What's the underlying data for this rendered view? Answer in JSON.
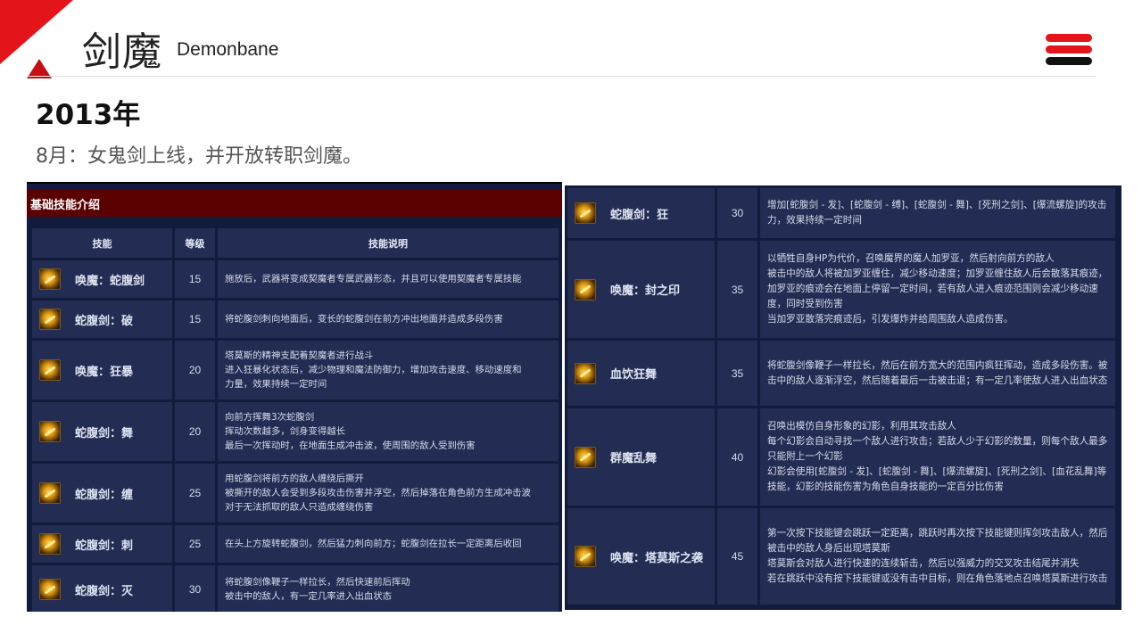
{
  "header": {
    "title": "剑魔",
    "subtitle": "Demonbane",
    "brand_red": "#e3151b"
  },
  "section": {
    "year": "2013年",
    "note": "8月：女鬼剑上线，并开放转职剑魔。"
  },
  "left_table": {
    "caption": "基础技能介绍",
    "headers": [
      "技能",
      "等级",
      "技能说明"
    ],
    "rows": [
      {
        "icon": "sword-summon-icon",
        "name": "唤魔：蛇腹剑",
        "level": "15",
        "desc": [
          "施放后，武器将变成契魔者专属武器形态，并且可以使用契魔者专属技能"
        ]
      },
      {
        "icon": "sword-break-icon",
        "name": "蛇腹剑：破",
        "level": "15",
        "desc": [
          "将蛇腹剑刺向地面后，变长的蛇腹剑在前方冲出地面并造成多段伤害"
        ]
      },
      {
        "icon": "frenzy-icon",
        "name": "唤魔：狂暴",
        "level": "20",
        "desc": [
          "塔莫斯的精神支配着契魔者进行战斗",
          "进入狂暴化状态后，减少物理和魔法防御力，增加攻击速度、移动速度和",
          "力量，效果持续一定时间"
        ]
      },
      {
        "icon": "sword-dance-icon",
        "name": "蛇腹剑：舞",
        "level": "20",
        "desc": [
          "向前方挥舞3次蛇腹剑",
          "挥动次数越多，剑身变得越长",
          "最后一次挥动时，在地面生成冲击波，使周围的敌人受到伤害"
        ]
      },
      {
        "icon": "sword-bind-icon",
        "name": "蛇腹剑：缠",
        "level": "25",
        "desc": [
          "用蛇腹剑将前方的敌人缠绕后撕开",
          "被撕开的敌人会受到多段攻击伤害并浮空，然后掉落在角色前方生成冲击波",
          "对于无法抓取的敌人只造成缠绕伤害"
        ]
      },
      {
        "icon": "sword-pierce-icon",
        "name": "蛇腹剑：刺",
        "level": "25",
        "desc": [
          "在头上方旋转蛇腹剑，然后猛力刺向前方；蛇腹剑在拉长一定距离后收回"
        ]
      },
      {
        "icon": "sword-destroy-icon",
        "name": "蛇腹剑：灭",
        "level": "30",
        "desc": [
          "将蛇腹剑像鞭子一样拉长，然后快速前后挥动",
          "被击中的敌人，有一定几率进入出血状态"
        ]
      }
    ]
  },
  "right_table": {
    "rows": [
      {
        "icon": "sword-frenzy-icon",
        "name": "蛇腹剑：狂",
        "level": "30",
        "desc": [
          "增加[蛇腹剑 - 发]、[蛇腹剑 - 缚]、[蛇腹剑 - 舞]、[死刑之剑]、[爆流螺旋]的攻击力，效果持续一定时间"
        ]
      },
      {
        "icon": "seal-icon",
        "name": "唤魔：封之印",
        "level": "35",
        "desc": [
          "以牺牲自身HP为代价，召唤魔界的魔人加罗亚，然后射向前方的敌人",
          "被击中的敌人将被加罗亚缠住，减少移动速度；加罗亚缠住敌人后会散落其痕迹，加罗亚的痕迹会在地面上停留一定时间，若有敌人进入痕迹范围则会减少移动速度，同时受到伤害",
          "当加罗亚散落完痕迹后，引发爆炸并给周围敌人造成伤害。"
        ]
      },
      {
        "icon": "blood-dance-icon",
        "name": "血饮狂舞",
        "level": "35",
        "desc": [
          "将蛇腹剑像鞭子一样拉长，然后在前方宽大的范围内疯狂挥动，造成多段伤害。被击中的敌人逐渐浮空，然后随着最后一击被击退；有一定几率使敌人进入出血状态"
        ]
      },
      {
        "icon": "demon-swarm-icon",
        "name": "群魔乱舞",
        "level": "40",
        "desc": [
          "召唤出模仿自身形象的幻影，利用其攻击敌人",
          "每个幻影会自动寻找一个敌人进行攻击；若敌人少于幻影的数量，则每个敌人最多只能附上一个幻影",
          "幻影会使用[蛇腹剑 - 发]、[蛇腹剑 - 舞]、[爆流螺旋]、[死刑之剑]、[血花乱舞]等技能，幻影的技能伤害为角色自身技能的一定百分比伤害"
        ]
      },
      {
        "icon": "tamos-attack-icon",
        "name": "唤魔：塔莫斯之袭",
        "level": "45",
        "desc": [
          "第一次按下技能键会跳跃一定距离，跳跃时再次按下技能键则挥剑攻击敌人，然后被击中的敌人身后出现塔莫斯",
          "塔莫斯会对敌人进行快速的连续斩击，然后以强威力的交叉攻击结尾并消失",
          "若在跳跃中没有按下技能键或没有击中目标，则在角色落地点召唤塔莫斯进行攻击"
        ]
      }
    ]
  }
}
